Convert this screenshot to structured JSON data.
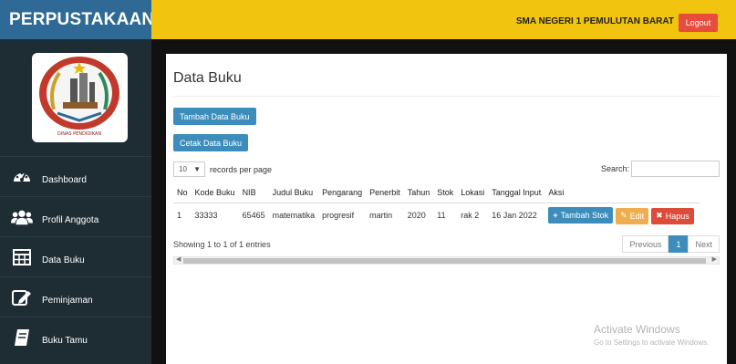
{
  "brand": {
    "title": "PERPUSTAKAAN"
  },
  "logo": {
    "caption": "DINAS PENDIDIKAN"
  },
  "sidebar": {
    "items": [
      {
        "label": "Dashboard",
        "icon": "dashboard-icon"
      },
      {
        "label": "Profil Anggota",
        "icon": "users-icon"
      },
      {
        "label": "Data Buku",
        "icon": "table-icon"
      },
      {
        "label": "Peminjaman",
        "icon": "edit-icon"
      },
      {
        "label": "Buku Tamu",
        "icon": "book-icon"
      }
    ]
  },
  "topbar": {
    "school": "SMA NEGERI 1 PEMULUTAN BARAT",
    "logout": "Logout"
  },
  "page": {
    "title": "Data Buku",
    "btn_tambah": "Tambah Data Buku",
    "btn_cetak": "Cetak Data Buku",
    "length_value": "10",
    "length_suffix": "records per page",
    "search_label": "Search:",
    "search_value": ""
  },
  "table": {
    "headers": [
      "No",
      "Kode Buku",
      "NIB",
      "Judul Buku",
      "Pengarang",
      "Penerbit",
      "Tahun",
      "Stok",
      "Lokasi",
      "Tanggal Input",
      "Aksi"
    ],
    "rows": [
      {
        "no": "1",
        "kode": "33333",
        "nib": "65465",
        "judul": "matematika",
        "pengarang": "progresif",
        "penerbit": "martin",
        "tahun": "2020",
        "stok": "11",
        "lokasi": "rak 2",
        "tanggal": "16 Jan 2022",
        "actions": {
          "tambah": "Tambah Stok",
          "edit": "Edit",
          "hapus": "Hapus"
        }
      }
    ]
  },
  "footer": {
    "info": "Showing 1 to 1 of 1 entries",
    "prev": "Previous",
    "page": "1",
    "next": "Next"
  },
  "watermark": {
    "line1": "Activate Windows",
    "line2": "Go to Settings to activate Windows."
  },
  "colors": {
    "brand": "#2e6a95",
    "topbar": "#f1c40f",
    "sidebar": "#1e2d34",
    "primary": "#3c8dbc",
    "danger": "#dd4b39",
    "warning": "#f0ad4e"
  }
}
